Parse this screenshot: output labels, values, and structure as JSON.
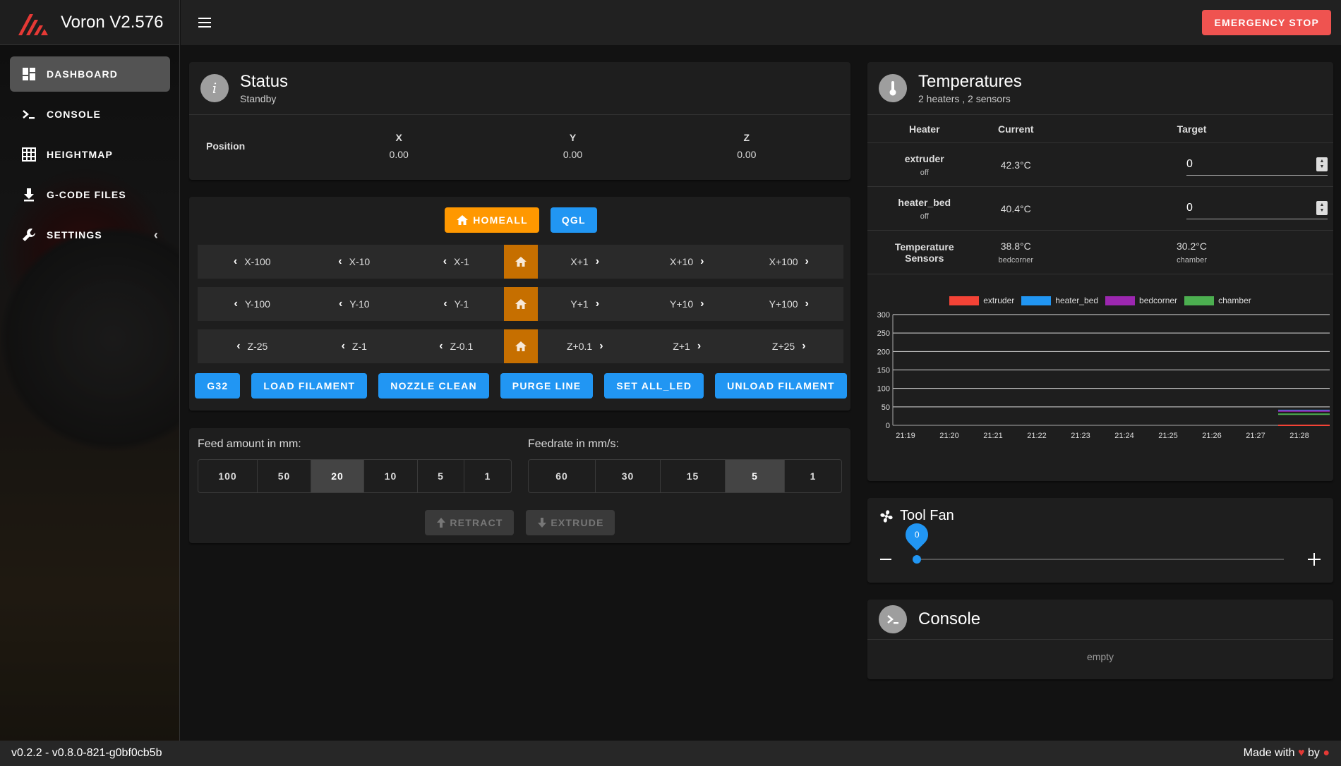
{
  "app": {
    "title": "Voron V2.576"
  },
  "topbar": {
    "estop_label": "EMERGENCY STOP"
  },
  "nav": {
    "items": [
      {
        "label": "DASHBOARD",
        "icon": "dashboard-icon",
        "active": true
      },
      {
        "label": "CONSOLE",
        "icon": "console-icon"
      },
      {
        "label": "HEIGHTMAP",
        "icon": "grid-icon"
      },
      {
        "label": "G-CODE FILES",
        "icon": "file-download-icon"
      },
      {
        "label": "SETTINGS",
        "icon": "wrench-icon"
      }
    ]
  },
  "status": {
    "title": "Status",
    "subtitle": "Standby",
    "position_label": "Position",
    "axes": [
      {
        "name": "X",
        "value": "0.00"
      },
      {
        "name": "Y",
        "value": "0.00"
      },
      {
        "name": "Z",
        "value": "0.00"
      }
    ]
  },
  "control": {
    "homeall_label": "HOMEALL",
    "qgl_label": "QGL",
    "jog_rows": [
      {
        "left": [
          "X-100",
          "X-10",
          "X-1"
        ],
        "right": [
          "X+1",
          "X+10",
          "X+100"
        ]
      },
      {
        "left": [
          "Y-100",
          "Y-10",
          "Y-1"
        ],
        "right": [
          "Y+1",
          "Y+10",
          "Y+100"
        ]
      },
      {
        "left": [
          "Z-25",
          "Z-1",
          "Z-0.1"
        ],
        "right": [
          "Z+0.1",
          "Z+1",
          "Z+25"
        ]
      }
    ],
    "macros": [
      "G32",
      "LOAD FILAMENT",
      "NOZZLE CLEAN",
      "PURGE LINE",
      "SET ALL_LED",
      "UNLOAD FILAMENT"
    ]
  },
  "extruder": {
    "feed_label": "Feed amount in mm:",
    "feed_options": [
      "100",
      "50",
      "20",
      "10",
      "5",
      "1"
    ],
    "feed_selected": "20",
    "rate_label": "Feedrate in mm/s:",
    "rate_options": [
      "60",
      "30",
      "15",
      "5",
      "1"
    ],
    "rate_selected": "5",
    "retract_label": "RETRACT",
    "extrude_label": "EXTRUDE"
  },
  "temperatures": {
    "title": "Temperatures",
    "subtitle": "2 heaters , 2 sensors",
    "col_heater": "Heater",
    "col_current": "Current",
    "col_target": "Target",
    "heaters": [
      {
        "name": "extruder",
        "state": "off",
        "current": "42.3°C",
        "target": "0"
      },
      {
        "name": "heater_bed",
        "state": "off",
        "current": "40.4°C",
        "target": "0"
      }
    ],
    "sensors_label_1": "Temperature",
    "sensors_label_2": "Sensors",
    "sensors": [
      {
        "name": "bedcorner",
        "value": "38.8°C"
      },
      {
        "name": "chamber",
        "value": "30.2°C"
      }
    ]
  },
  "chart_data": {
    "type": "line",
    "title": "",
    "xlabel": "",
    "ylabel": "",
    "ylim": [
      0,
      300
    ],
    "yticks": [
      0,
      50,
      100,
      150,
      200,
      250,
      300
    ],
    "categories": [
      "21:19",
      "21:20",
      "21:21",
      "21:22",
      "21:23",
      "21:24",
      "21:25",
      "21:26",
      "21:27",
      "21:28"
    ],
    "x_start": "21:28",
    "series": [
      {
        "name": "extruder",
        "color": "#f44336",
        "values": [
          0,
          0
        ],
        "target": 0
      },
      {
        "name": "heater_bed",
        "color": "#2196f3",
        "values": [
          40.4,
          40.4
        ]
      },
      {
        "name": "bedcorner",
        "color": "#9c27b0",
        "values": [
          38.8,
          38.8
        ]
      },
      {
        "name": "chamber",
        "color": "#4caf50",
        "values": [
          30.2,
          30.2
        ]
      }
    ],
    "legend_position": "top"
  },
  "fan": {
    "title": "Tool Fan",
    "value": "0",
    "level": 0
  },
  "console": {
    "title": "Console",
    "empty_text": "empty"
  },
  "footer": {
    "version": "v0.2.2 - v0.8.0-821-g0bf0cb5b",
    "made_with": "Made with",
    "by": "by"
  },
  "colors": {
    "accent": "#2196f3",
    "orange": "#ff9800",
    "estop": "#ef5350",
    "home_cell": "#c66f00"
  }
}
